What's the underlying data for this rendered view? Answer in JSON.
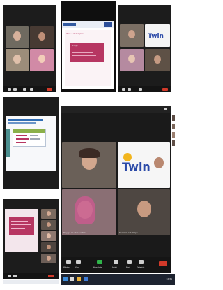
{
  "panels": {
    "p1": {
      "time": ""
    },
    "p2": {
      "slide_title": "Web 2.0 Araçları",
      "card_title": "Proje",
      "lines": [
        "",
        ""
      ]
    },
    "p3": {
      "logo": "Twin"
    },
    "p5": {
      "caption_left": "Duygu de Tam ve Siz",
      "caption_right": "Kadriye Gül Yalçın",
      "logo": "Twin"
    },
    "p5_bar": {
      "items": [
        "Mikrofon",
        "Video",
        "Ekran Paylaş",
        "Sohbet",
        "Kayıt",
        "Toplantılar"
      ]
    },
    "p7": {
      "time": "12:31"
    }
  },
  "colors": {
    "dark": "#1c1c1c",
    "accent_red": "#d23a2a",
    "pink": "#b73662",
    "twin_blue": "#2b4aa8"
  }
}
